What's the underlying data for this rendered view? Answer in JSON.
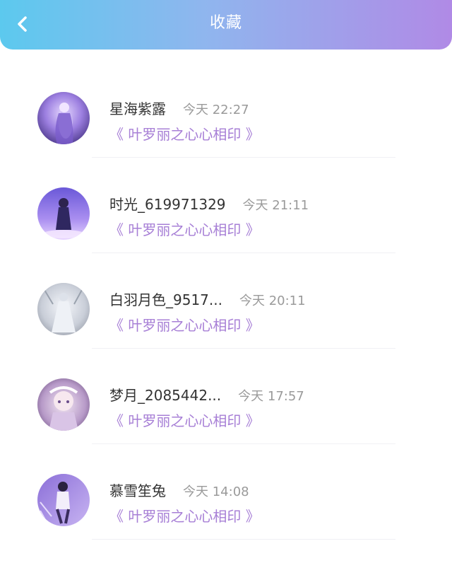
{
  "header": {
    "title": "收藏",
    "back_icon": "chevron-left-icon"
  },
  "colors": {
    "header_gradient_start": "#5cc9ee",
    "header_gradient_end": "#b08ae6",
    "book_title": "#a77fd6",
    "name_text": "#333333",
    "time_text": "#9a9a9a"
  },
  "items": [
    {
      "name": "星海紫露",
      "time": "今天 22:27",
      "book": "《 叶罗丽之心心相印 》"
    },
    {
      "name": "时光_619971329",
      "time": "今天 21:11",
      "book": "《 叶罗丽之心心相印 》"
    },
    {
      "name": "白羽月色_9517...",
      "time": "今天 20:11",
      "book": "《 叶罗丽之心心相印 》"
    },
    {
      "name": "梦月_2085442...",
      "time": "今天 17:57",
      "book": "《 叶罗丽之心心相印 》"
    },
    {
      "name": "慕雪笙兔",
      "time": "今天 14:08",
      "book": "《 叶罗丽之心心相印 》"
    }
  ]
}
